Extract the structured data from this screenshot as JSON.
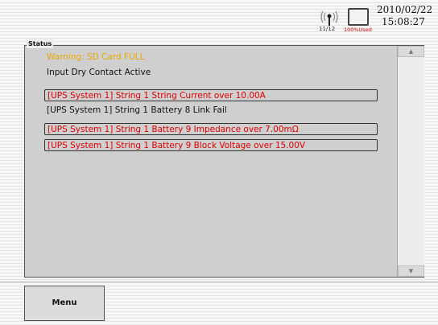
{
  "header": {
    "signal_count": "11/12",
    "sd_usage": "100%Used",
    "date": "2010/02/22",
    "time": "15:08:27"
  },
  "status": {
    "label": "Status",
    "items": [
      {
        "text": "Warning: SD Card FULL",
        "color": "#e8a800",
        "boxed": false
      },
      {
        "text": "Input Dry Contact Active",
        "color": "#111111",
        "boxed": false
      },
      {
        "text": "[UPS System 1] String 1 String Current over 10.00A",
        "color": "#e00000",
        "boxed": true
      },
      {
        "text": "[UPS System 1] String 1 Battery 8 Link Fail",
        "color": "#111111",
        "boxed": false
      },
      {
        "text": "[UPS System 1] String 1 Battery 9 Impedance over 7.00mΩ",
        "color": "#e00000",
        "boxed": true
      },
      {
        "text": "[UPS System 1] String 1 Battery 9 Block Voltage over 15.00V",
        "color": "#e00000",
        "boxed": true
      }
    ]
  },
  "scroll": {
    "up": "▲",
    "down": "▼"
  },
  "menu": {
    "label": "Menu"
  },
  "icons": {
    "signal": "antenna-signal-icon",
    "storage": "sd-card-icon"
  }
}
